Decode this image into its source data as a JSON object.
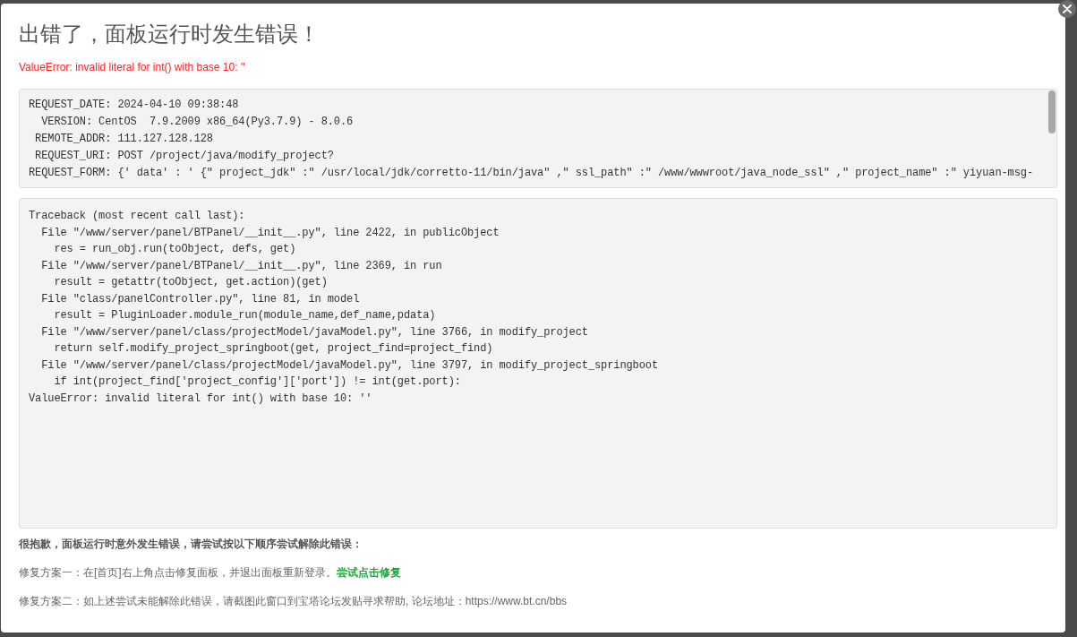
{
  "dialog": {
    "title": "出错了，面板运行时发生错误！",
    "error_message": "ValueError: invalid literal for int() with base 10: ''",
    "request_info": [
      "REQUEST_DATE: 2024-04-10 09:38:48",
      "  VERSION: CentOS  7.9.2009 x86_64(Py3.7.9) - 8.0.6",
      " REMOTE_ADDR: 111.127.128.128",
      " REQUEST_URI: POST /project/java/modify_project?",
      "REQUEST_FORM: {' data' : ' {\" project_jdk\" :\" /usr/local/jdk/corretto-11/bin/java\" ,\" ssl_path\" :\" /www/wwwroot/java_node_ssl\" ,\" project_name\" :\" yiyuan-msg-"
    ],
    "traceback": [
      "Traceback (most recent call last):",
      "  File \"/www/server/panel/BTPanel/__init__.py\", line 2422, in publicObject",
      "    res = run_obj.run(toObject, defs, get)",
      "  File \"/www/server/panel/BTPanel/__init__.py\", line 2369, in run",
      "    result = getattr(toObject, get.action)(get)",
      "  File \"class/panelController.py\", line 81, in model",
      "    result = PluginLoader.module_run(module_name,def_name,pdata)",
      "  File \"/www/server/panel/class/projectModel/javaModel.py\", line 3766, in modify_project",
      "    return self.modify_project_springboot(get, project_find=project_find)",
      "  File \"/www/server/panel/class/projectModel/javaModel.py\", line 3797, in modify_project_springboot",
      "    if int(project_find['project_config']['port']) != int(get.port):",
      "ValueError: invalid literal for int() with base 10: ''"
    ],
    "help": {
      "heading": "很抱歉，面板运行时意外发生错误，请尝试按以下顺序尝试解除此错误：",
      "solutions": [
        {
          "text": "修复方案一：在[首页]右上角点击修复面板，并退出面板重新登录。",
          "link": "尝试点击修复"
        },
        {
          "text": "修复方案二：如上述尝试未能解除此错误，请截图此窗口到宝塔论坛发贴寻求帮助, 论坛地址：https://www.bt.cn/bbs"
        }
      ]
    }
  }
}
